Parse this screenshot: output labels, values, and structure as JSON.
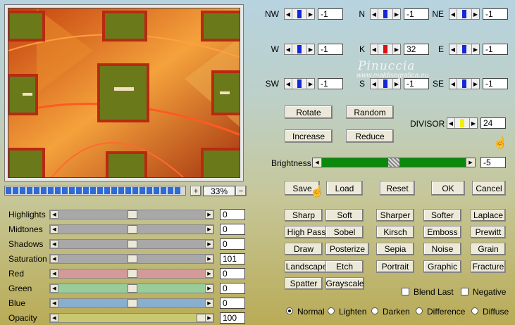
{
  "matrix": {
    "cells": [
      {
        "label": "NW",
        "value": "-1",
        "mark": "#1428d8"
      },
      {
        "label": "N",
        "value": "-1",
        "mark": "#1428d8"
      },
      {
        "label": "NE",
        "value": "-1",
        "mark": "#1428d8"
      },
      {
        "label": "W",
        "value": "-1",
        "mark": "#1428d8"
      },
      {
        "label": "K",
        "value": "32",
        "mark": "#e01010"
      },
      {
        "label": "E",
        "value": "-1",
        "mark": "#1428d8"
      },
      {
        "label": "SW",
        "value": "-1",
        "mark": "#1428d8"
      },
      {
        "label": "S",
        "value": "-1",
        "mark": "#1428d8"
      },
      {
        "label": "SE",
        "value": "-1",
        "mark": "#1428d8"
      }
    ]
  },
  "watermark": {
    "line1": "Pinuccia",
    "line2": "www.maldisegrafica.eu"
  },
  "buttons": {
    "rotate": "Rotate",
    "random": "Random",
    "increase": "Increase",
    "reduce": "Reduce",
    "save": "Save",
    "load": "Load",
    "reset": "Reset",
    "ok": "OK",
    "cancel": "Cancel"
  },
  "divisor": {
    "label": "DIVISOR",
    "value": "24",
    "mark": "#f0f000"
  },
  "brightness": {
    "label": "Brightness",
    "value": "-5"
  },
  "zoom": {
    "value": "33%",
    "plus": "+",
    "minus": "−",
    "progress_segments": 25
  },
  "adjust": [
    {
      "label": "Highlights",
      "value": "0",
      "track": "#a8a8a8",
      "level": 0.5
    },
    {
      "label": "Midtones",
      "value": "0",
      "track": "#a8a8a8",
      "level": 0.5
    },
    {
      "label": "Shadows",
      "value": "0",
      "track": "#a8a8a8",
      "level": 0.5
    },
    {
      "label": "Saturation",
      "value": "101",
      "track": "#a8a8a8",
      "level": 0.5
    },
    {
      "label": "Red",
      "value": "0",
      "track": "#d49a9a",
      "level": 0.5
    },
    {
      "label": "Green",
      "value": "0",
      "track": "#98cc98",
      "level": 0.5
    },
    {
      "label": "Blue",
      "value": "0",
      "track": "#88aed0",
      "level": 0.5
    },
    {
      "label": "Opacity",
      "value": "100",
      "track": "#c8c870",
      "level": 1.0
    }
  ],
  "presets": [
    [
      "Sharp",
      "Soft",
      "Sharper",
      "Softer",
      "Laplace"
    ],
    [
      "High Pass",
      "Sobel",
      "Kirsch",
      "Emboss",
      "Prewitt"
    ],
    [
      "Draw",
      "Posterize",
      "Sepia",
      "Noise",
      "Grain"
    ],
    [
      "Landscape",
      "Etch",
      "Portrait",
      "Graphic",
      "Fracture"
    ],
    [
      "Spatter",
      "Grayscale"
    ]
  ],
  "options": {
    "blend_last": "Blend Last",
    "negative": "Negative"
  },
  "modes": [
    {
      "label": "Normal",
      "selected": true
    },
    {
      "label": "Lighten",
      "selected": false
    },
    {
      "label": "Darken",
      "selected": false
    },
    {
      "label": "Difference",
      "selected": false
    },
    {
      "label": "Diffuse",
      "selected": false
    }
  ]
}
